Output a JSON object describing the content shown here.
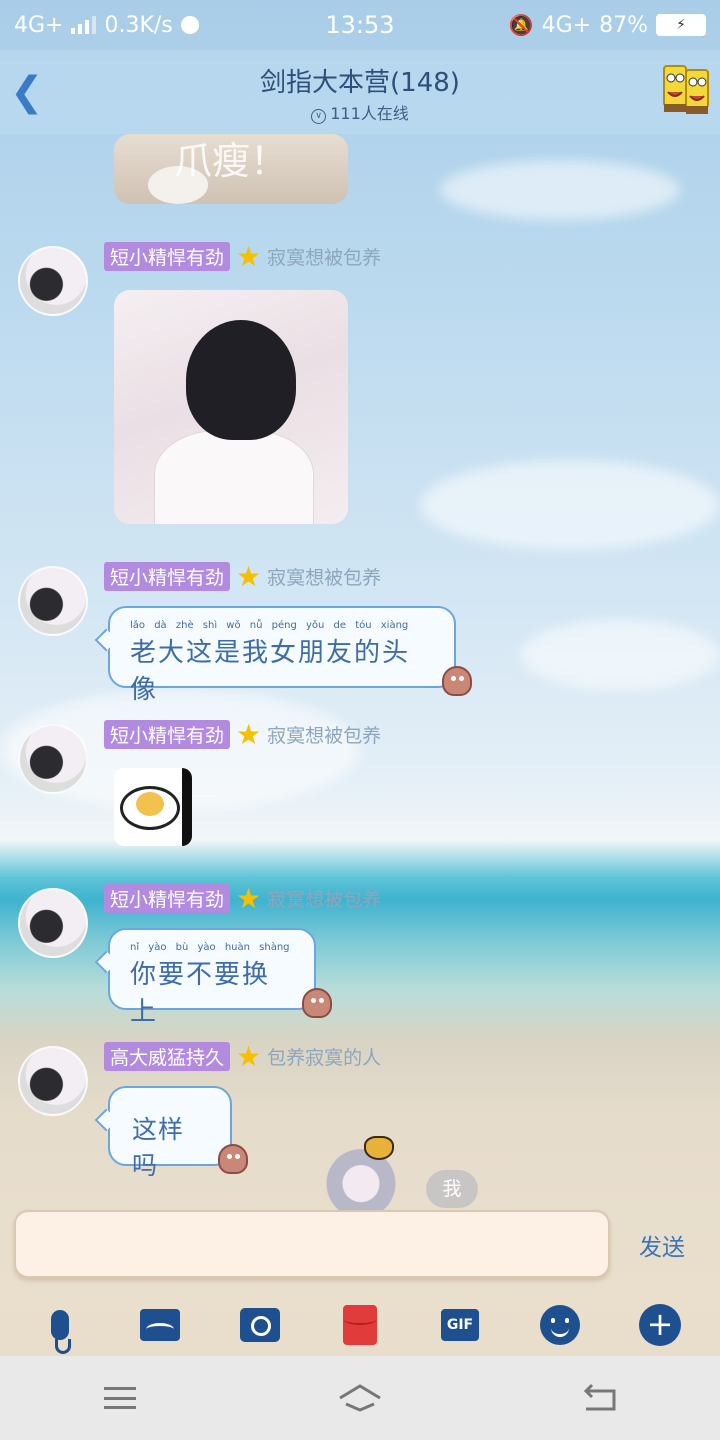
{
  "status_bar": {
    "network_left": "4G+",
    "speed": "0.3K/s",
    "time": "13:53",
    "network_right": "4G+",
    "battery": "87%"
  },
  "header": {
    "group_name": "剑指大本营(148)",
    "online_count": "111人在线",
    "back_icon": "chevron-left-icon",
    "profile_icon": "spongebob-avatar-icon"
  },
  "messages": [
    {
      "type": "image",
      "image_desc": "cat-paw-sticker",
      "watermark_text": "爪瘦！"
    },
    {
      "sender": "短小精悍有劲",
      "badge_icon": "star-icon",
      "title": "寂寞想被包养",
      "type": "image",
      "image_desc": "anime-girl-photo"
    },
    {
      "sender": "短小精悍有劲",
      "badge_icon": "star-icon",
      "title": "寂寞想被包养",
      "type": "text",
      "pinyin": "lǎo dà zhè shì wǒ nǚ péng yǒu de tóu xiàng",
      "text": "老大这是我女朋友的头像"
    },
    {
      "sender": "短小精悍有劲",
      "badge_icon": "star-icon",
      "title": "寂寞想被包养",
      "type": "sticker",
      "image_desc": "fried-egg-sticker"
    },
    {
      "sender": "短小精悍有劲",
      "badge_icon": "star-icon",
      "title": "寂寞想被包养",
      "type": "text",
      "pinyin": "nǐ yào bù yào huàn shàng",
      "text": "你要不要换上"
    },
    {
      "sender": "高大威猛持久",
      "badge_icon": "star-icon",
      "title": "包养寂寞的人",
      "type": "text",
      "text": "这样吗"
    }
  ],
  "me_badge": "我",
  "input": {
    "value": "",
    "send_label": "发送"
  },
  "toolbar": {
    "items": [
      "microphone-icon",
      "image-icon",
      "camera-icon",
      "red-packet-icon",
      "gif-icon",
      "emoji-icon",
      "plus-icon"
    ],
    "gif_label": "GIF",
    "plus_label": "+"
  },
  "navbar": {
    "items": [
      "menu-icon",
      "home-icon",
      "back-icon"
    ]
  },
  "colors": {
    "accent": "#3a7bc8",
    "nick_bg": "#b28be0",
    "bubble_border": "#6ba6de",
    "toolbar_icon": "#1e4f8e"
  }
}
